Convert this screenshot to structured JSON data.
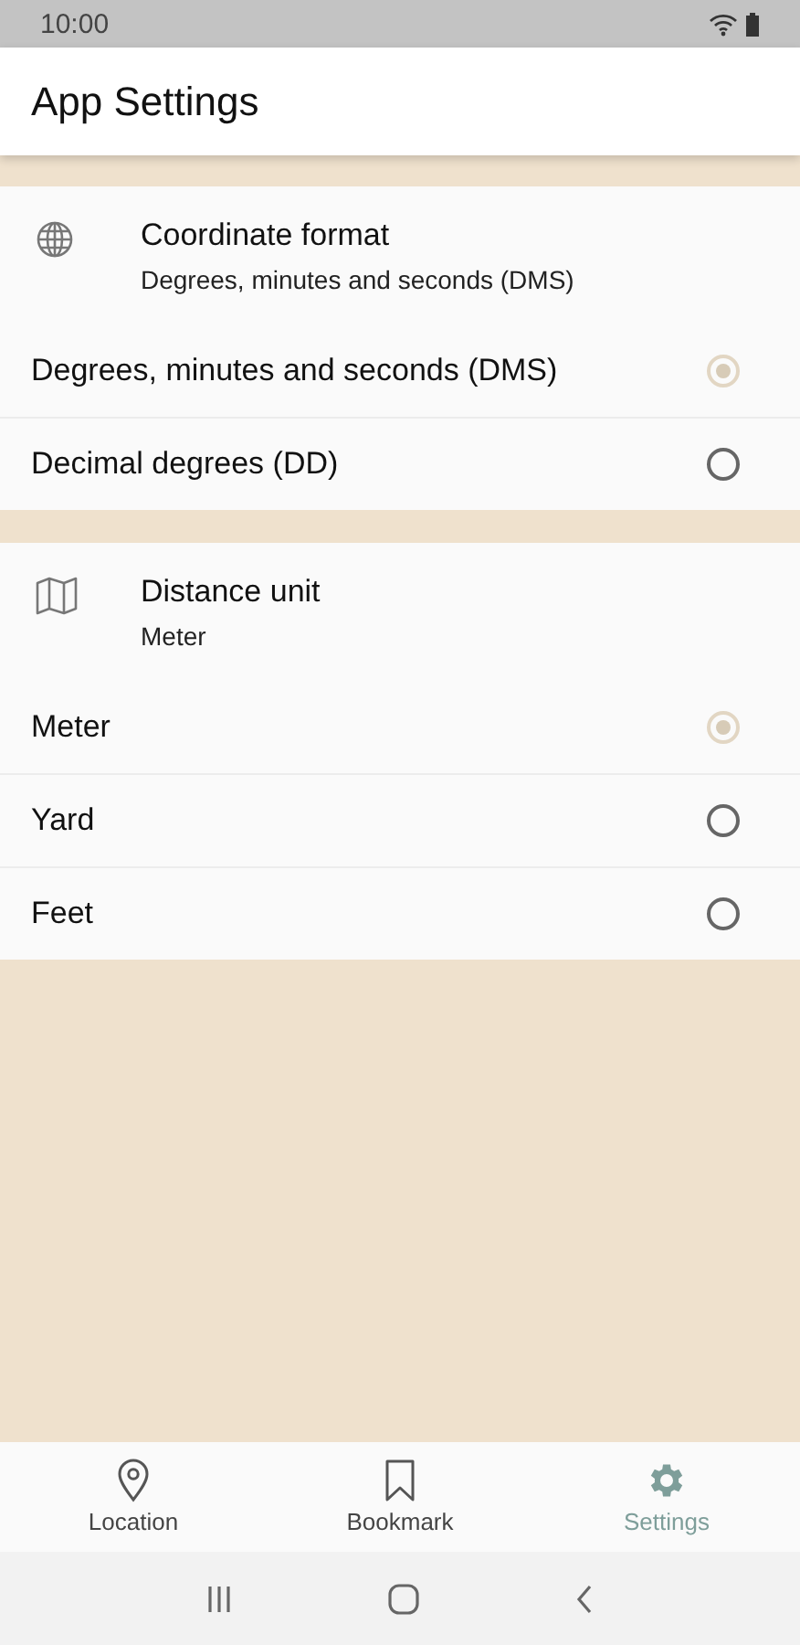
{
  "status_bar": {
    "time": "10:00"
  },
  "app_bar": {
    "title": "App Settings"
  },
  "sections": [
    {
      "title": "Coordinate format",
      "summary": "Degrees, minutes and seconds (DMS)",
      "options": [
        {
          "label": "Degrees, minutes and seconds (DMS)",
          "selected": true
        },
        {
          "label": "Decimal degrees (DD)",
          "selected": false
        }
      ]
    },
    {
      "title": "Distance unit",
      "summary": "Meter",
      "options": [
        {
          "label": "Meter",
          "selected": true
        },
        {
          "label": "Yard",
          "selected": false
        },
        {
          "label": "Feet",
          "selected": false
        }
      ]
    }
  ],
  "bottom_nav": [
    {
      "label": "Location",
      "selected": false
    },
    {
      "label": "Bookmark",
      "selected": false
    },
    {
      "label": "Settings",
      "selected": true
    }
  ]
}
